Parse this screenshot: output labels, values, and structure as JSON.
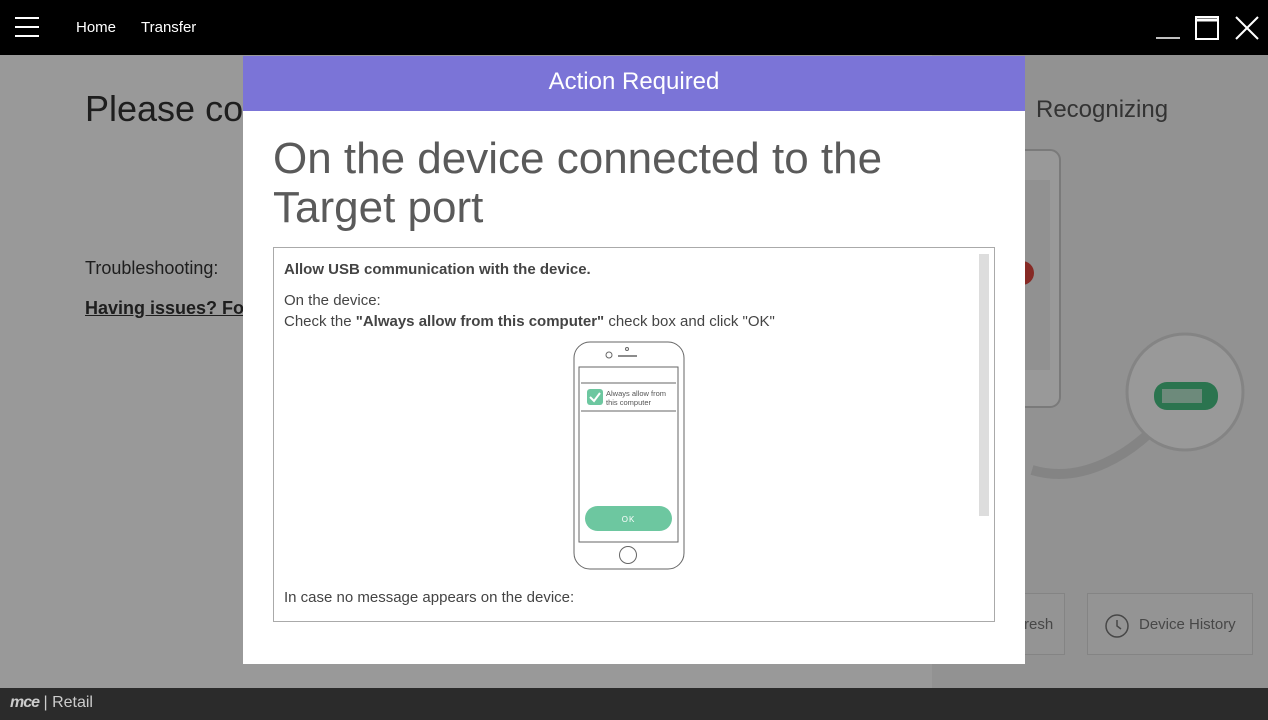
{
  "topbar": {
    "nav": [
      "Home",
      "Transfer"
    ]
  },
  "background": {
    "title": "Please cor",
    "troubleshooting": "Troubleshooting:",
    "issues_link": "Having issues? Foll",
    "recognizing": "Recognizing",
    "refresh_label": "resh",
    "history_label": "Device History"
  },
  "modal": {
    "header": "Action Required",
    "heading": "On the device connected to the Target port",
    "allow_title": "Allow USB communication with the device.",
    "on_device": "On the device:",
    "check_prefix": "Check the ",
    "check_bold": "\"Always allow from this computer\"",
    "check_suffix": " check box and click \"OK\"",
    "phone_checkbox_label_1": "Always allow from",
    "phone_checkbox_label_2": "this computer",
    "phone_ok": "OK",
    "no_message": "In case no message appears on the device:"
  },
  "footer": {
    "brand_logo": "mce",
    "brand_sep": " | ",
    "brand_text": "Retail"
  },
  "colors": {
    "header": "#7b74d7",
    "ok_button": "#6dc7a0",
    "topbar": "#000000",
    "footer": "#2b2b2b"
  }
}
